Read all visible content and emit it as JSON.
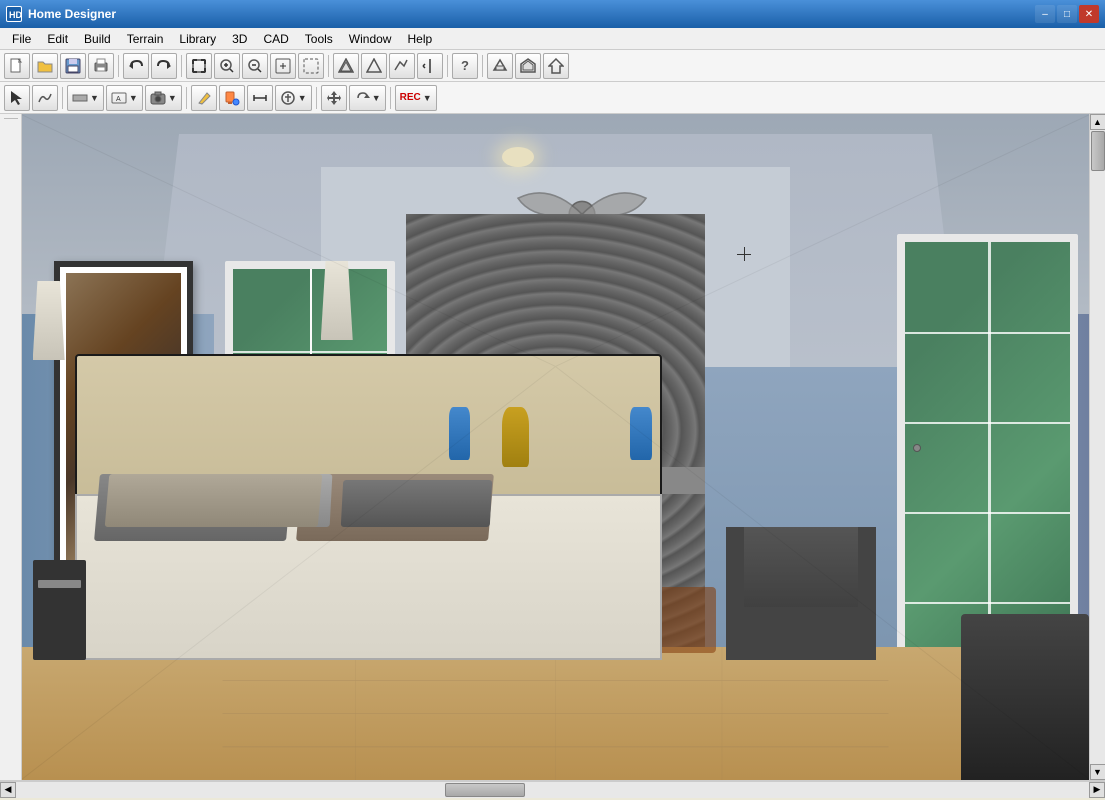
{
  "app": {
    "title": "Home Designer",
    "icon": "HD"
  },
  "titlebar": {
    "minimize": "–",
    "restore": "□",
    "close": "✕"
  },
  "menu": {
    "items": [
      "File",
      "Edit",
      "Build",
      "Terrain",
      "Library",
      "3D",
      "CAD",
      "Tools",
      "Window",
      "Help"
    ]
  },
  "toolbar1": {
    "buttons": [
      {
        "name": "new",
        "icon": "📄"
      },
      {
        "name": "open",
        "icon": "📂"
      },
      {
        "name": "save",
        "icon": "💾"
      },
      {
        "name": "print",
        "icon": "🖨"
      },
      {
        "name": "undo",
        "icon": "↩"
      },
      {
        "name": "redo",
        "icon": "↪"
      },
      {
        "name": "zoom-fit",
        "icon": "⊡"
      },
      {
        "name": "zoom-in",
        "icon": "🔍"
      },
      {
        "name": "zoom-out",
        "icon": "🔎"
      },
      {
        "name": "zoom-realtime",
        "icon": "⊞"
      },
      {
        "name": "zoom-select",
        "icon": "⊟"
      },
      {
        "name": "toolbar-btn-a",
        "icon": "⊠"
      },
      {
        "name": "toolbar-btn-b",
        "icon": "⊡"
      },
      {
        "name": "toolbar-btn-c",
        "icon": "◈"
      },
      {
        "name": "toolbar-btn-d",
        "icon": "◉"
      },
      {
        "name": "toolbar-btn-e",
        "icon": "⬡"
      },
      {
        "name": "toolbar-btn-f",
        "icon": "↑"
      },
      {
        "name": "toolbar-btn-g",
        "icon": "?"
      },
      {
        "name": "toolbar-btn-h",
        "icon": "⬜"
      },
      {
        "name": "toolbar-btn-i",
        "icon": "🏠"
      },
      {
        "name": "toolbar-btn-j",
        "icon": "⌂"
      },
      {
        "name": "toolbar-btn-k",
        "icon": "🏡"
      }
    ]
  },
  "toolbar2": {
    "buttons": [
      {
        "name": "select",
        "icon": "↖"
      },
      {
        "name": "draw-poly",
        "icon": "∿"
      },
      {
        "name": "draw-line",
        "icon": "—"
      },
      {
        "name": "wall-tool",
        "icon": "⊞"
      },
      {
        "name": "room-tool",
        "icon": "⊡"
      },
      {
        "name": "camera",
        "icon": "📷"
      },
      {
        "name": "tb2-a",
        "icon": "✏"
      },
      {
        "name": "tb2-b",
        "icon": "🖊"
      },
      {
        "name": "tb2-c",
        "icon": "⊕"
      },
      {
        "name": "tb2-d",
        "icon": "◈"
      },
      {
        "name": "tb2-e",
        "icon": "↑"
      },
      {
        "name": "tb2-f",
        "icon": "↕"
      },
      {
        "name": "tb2-g",
        "icon": "⊞"
      },
      {
        "name": "tb2-h",
        "icon": "REC"
      }
    ]
  },
  "scene": {
    "description": "3D bedroom interior view with fireplace, bed, and furniture"
  },
  "statusbar": {
    "text": ""
  }
}
